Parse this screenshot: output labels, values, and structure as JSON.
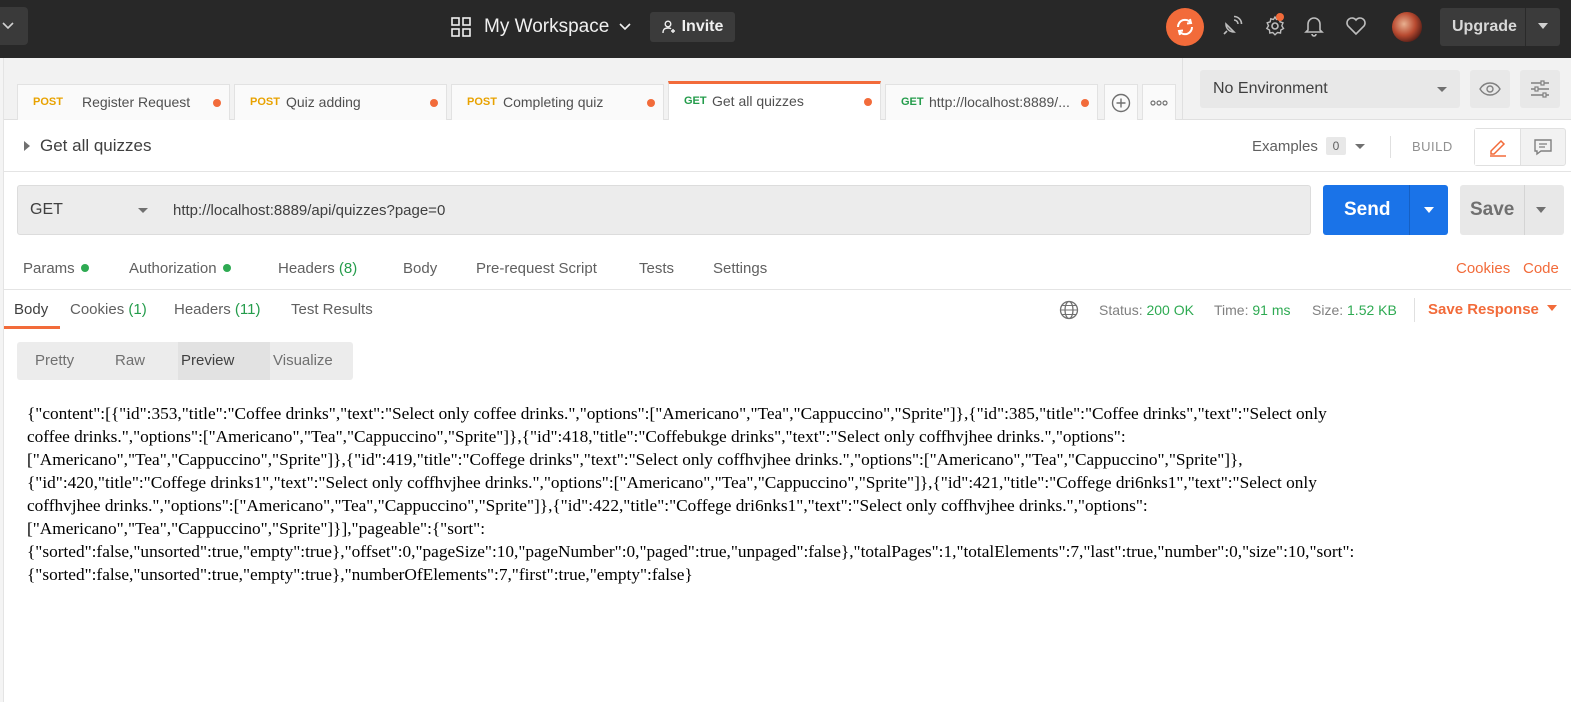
{
  "header": {
    "workspace_name": "My Workspace",
    "invite_label": "Invite",
    "upgrade_label": "Upgrade",
    "accent_color": "#f26b3a"
  },
  "tabs": [
    {
      "method": "POST",
      "name": "Register Request"
    },
    {
      "method": "POST",
      "name": "Quiz adding"
    },
    {
      "method": "POST",
      "name": "Completing quiz"
    },
    {
      "method": "GET",
      "name": "Get all quizzes"
    },
    {
      "method": "GET",
      "name": "http://localhost:8889/..."
    }
  ],
  "environment": {
    "selected": "No Environment"
  },
  "request": {
    "title": "Get all quizzes",
    "examples_label": "Examples",
    "examples_count": "0",
    "build_label": "BUILD",
    "method": "GET",
    "url": "http://localhost:8889/api/quizzes?page=0",
    "send_label": "Send",
    "save_label": "Save"
  },
  "request_tabs": {
    "params": "Params",
    "authorization": "Authorization",
    "headers": "Headers",
    "headers_count": "(8)",
    "body": "Body",
    "prerequest": "Pre-request Script",
    "tests": "Tests",
    "settings": "Settings",
    "cookies_link": "Cookies",
    "code_link": "Code"
  },
  "response_tabs": {
    "body": "Body",
    "cookies": "Cookies",
    "cookies_count": "(1)",
    "headers": "Headers",
    "headers_count": "(11)",
    "test_results": "Test Results"
  },
  "response_status": {
    "status_label": "Status:",
    "status_value": "200 OK",
    "time_label": "Time:",
    "time_value": "91 ms",
    "size_label": "Size:",
    "size_value": "1.52 KB",
    "save_response": "Save Response"
  },
  "view_modes": {
    "pretty": "Pretty",
    "raw": "Raw",
    "preview": "Preview",
    "visualize": "Visualize",
    "selected": "Preview"
  },
  "response_body_lines": [
    "{\"content\":[{\"id\":353,\"title\":\"Coffee drinks\",\"text\":\"Select only coffee drinks.\",\"options\":[\"Americano\",\"Tea\",\"Cappuccino\",\"Sprite\"]},{\"id\":385,\"title\":\"Coffee drinks\",\"text\":\"Select only",
    "coffee drinks.\",\"options\":[\"Americano\",\"Tea\",\"Cappuccino\",\"Sprite\"]},{\"id\":418,\"title\":\"Coffebukge drinks\",\"text\":\"Select only coffhvjhee drinks.\",\"options\":",
    "[\"Americano\",\"Tea\",\"Cappuccino\",\"Sprite\"]},{\"id\":419,\"title\":\"Coffege drinks\",\"text\":\"Select only coffhvjhee drinks.\",\"options\":[\"Americano\",\"Tea\",\"Cappuccino\",\"Sprite\"]},",
    "{\"id\":420,\"title\":\"Coffege drinks1\",\"text\":\"Select only coffhvjhee drinks.\",\"options\":[\"Americano\",\"Tea\",\"Cappuccino\",\"Sprite\"]},{\"id\":421,\"title\":\"Coffege dri6nks1\",\"text\":\"Select only",
    "coffhvjhee drinks.\",\"options\":[\"Americano\",\"Tea\",\"Cappuccino\",\"Sprite\"]},{\"id\":422,\"title\":\"Coffege dri6nks1\",\"text\":\"Select only coffhvjhee drinks.\",\"options\":",
    "[\"Americano\",\"Tea\",\"Cappuccino\",\"Sprite\"]}],\"pageable\":{\"sort\":",
    "{\"sorted\":false,\"unsorted\":true,\"empty\":true},\"offset\":0,\"pageSize\":10,\"pageNumber\":0,\"paged\":true,\"unpaged\":false},\"totalPages\":1,\"totalElements\":7,\"last\":true,\"number\":0,\"size\":10,\"sort\":",
    "{\"sorted\":false,\"unsorted\":true,\"empty\":true},\"numberOfElements\":7,\"first\":true,\"empty\":false}"
  ]
}
